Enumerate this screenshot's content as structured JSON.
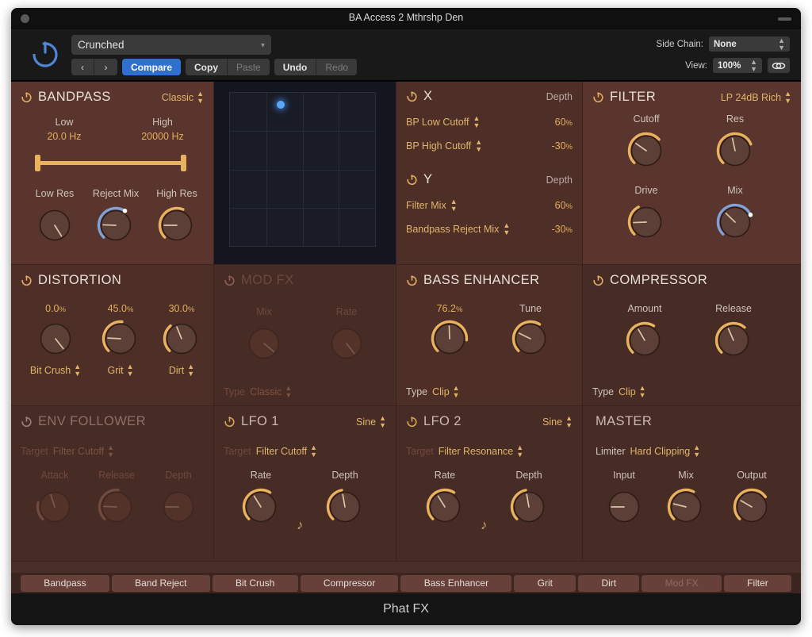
{
  "window": {
    "title": "BA Access 2 Mthrshp Den",
    "footer_name": "Phat FX"
  },
  "toolbar": {
    "power_icon": "power-icon",
    "preset_name": "Crunched",
    "prev_label": "‹",
    "next_label": "›",
    "compare_label": "Compare",
    "copy_label": "Copy",
    "paste_label": "Paste",
    "undo_label": "Undo",
    "redo_label": "Redo",
    "sidechain_label": "Side Chain:",
    "sidechain_value": "None",
    "view_label": "View:",
    "view_value": "100%",
    "link_icon": "link-icon",
    "accent_blue": "#2f6fd0"
  },
  "bandpass": {
    "title": "BANDPASS",
    "mode": "Classic",
    "low_label": "Low",
    "low_value": "20.0 Hz",
    "high_label": "High",
    "high_value": "20000 Hz",
    "knobs": [
      {
        "label": "Low Res",
        "arc": 0,
        "angle": -122
      },
      {
        "label": "Reject Mix",
        "arc": 62,
        "angle": 2
      },
      {
        "label": "High Res",
        "arc": 58,
        "angle": 0
      }
    ]
  },
  "xypad": {
    "dot_x_pct": 35,
    "dot_y_pct": 8,
    "grid_divisions": 4
  },
  "xy_assign": {
    "x_title": "X",
    "x_depth_label": "Depth",
    "x_rows": [
      {
        "name": "BP Low Cutoff",
        "value": "60",
        "unit": "%"
      },
      {
        "name": "BP High Cutoff",
        "value": "-30",
        "unit": "%"
      }
    ],
    "y_title": "Y",
    "y_depth_label": "Depth",
    "y_rows": [
      {
        "name": "Filter Mix",
        "value": "60",
        "unit": "%"
      },
      {
        "name": "Bandpass Reject Mix",
        "value": "-30",
        "unit": "%"
      }
    ]
  },
  "filter": {
    "title": "FILTER",
    "mode": "LP 24dB Rich",
    "knobs": [
      {
        "label": "Cutoff",
        "arc": 68,
        "angle": 35
      },
      {
        "label": "Res",
        "arc": 75,
        "angle": 78
      },
      {
        "label": "Drive",
        "arc": 40,
        "angle": -2
      },
      {
        "label": "Mix",
        "arc": 74,
        "angle": 44,
        "color": "blue"
      }
    ]
  },
  "distortion": {
    "title": "DISTORTION",
    "knobs": [
      {
        "value": "0.0",
        "unit": "%",
        "label": "Bit Crush",
        "arc": 0,
        "angle": -128
      },
      {
        "value": "45.0",
        "unit": "%",
        "label": "Grit",
        "arc": 52,
        "angle": 3
      },
      {
        "value": "30.0",
        "unit": "%",
        "label": "Dirt",
        "arc": 35,
        "angle": 68
      }
    ]
  },
  "modfx": {
    "title": "MOD FX",
    "enabled": false,
    "knobs": [
      {
        "label": "Mix",
        "arc": 0,
        "angle": -140
      },
      {
        "label": "Rate",
        "arc": 0,
        "angle": -128
      }
    ],
    "type_key": "Type",
    "type_value": "Classic"
  },
  "bass_enhancer": {
    "title": "BASS ENHANCER",
    "knobs": [
      {
        "value": "76.2",
        "unit": "%",
        "arc": 85,
        "angle": 88
      },
      {
        "label": "Tune",
        "arc": 62,
        "angle": 26
      }
    ],
    "type_key": "Type",
    "type_value": "Clip"
  },
  "compressor": {
    "title": "COMPRESSOR",
    "knobs": [
      {
        "label": "Amount",
        "arc": 62,
        "angle": 60
      },
      {
        "label": "Release",
        "arc": 65,
        "angle": 66
      }
    ],
    "type_key": "Type",
    "type_value": "Clip"
  },
  "env_follower": {
    "title": "ENV FOLLOWER",
    "enabled": false,
    "target_key": "Target",
    "target_value": "Filter Cutoff",
    "knobs": [
      {
        "label": "Attack",
        "arc": 22,
        "angle": 72
      },
      {
        "label": "Release",
        "arc": 52,
        "angle": 2
      },
      {
        "label": "Depth",
        "arc": 0,
        "angle": 0
      }
    ]
  },
  "lfo1": {
    "title": "LFO 1",
    "wave": "Sine",
    "target_key": "Target",
    "target_value": "Filter Cutoff",
    "knobs": [
      {
        "label": "Rate",
        "arc": 62,
        "angle": 58
      },
      {
        "label": "Depth",
        "arc": 46,
        "angle": 80
      }
    ],
    "sync_icon": "note-icon"
  },
  "lfo2": {
    "title": "LFO 2",
    "wave": "Sine",
    "target_key": "Target",
    "target_value": "Filter Resonance",
    "knobs": [
      {
        "label": "Rate",
        "arc": 62,
        "angle": 58
      },
      {
        "label": "Depth",
        "arc": 46,
        "angle": 80
      }
    ],
    "sync_icon": "note-icon"
  },
  "master": {
    "title": "MASTER",
    "limiter_key": "Limiter",
    "limiter_value": "Hard Clipping",
    "knobs": [
      {
        "label": "Input",
        "arc": 0,
        "angle": 0
      },
      {
        "label": "Mix",
        "arc": 60,
        "angle": 14
      },
      {
        "label": "Output",
        "arc": 70,
        "angle": 30
      }
    ]
  },
  "tabs": [
    {
      "label": "Bandpass",
      "enabled": true
    },
    {
      "label": "Band Reject",
      "enabled": true
    },
    {
      "label": "Bit Crush",
      "enabled": true
    },
    {
      "label": "Compressor",
      "enabled": true
    },
    {
      "label": "Bass Enhancer",
      "enabled": true
    },
    {
      "label": "Grit",
      "enabled": true
    },
    {
      "label": "Dirt",
      "enabled": true
    },
    {
      "label": "Mod FX",
      "enabled": false
    },
    {
      "label": "Filter",
      "enabled": true
    }
  ],
  "colors": {
    "amber": "#e3ad5e",
    "blue": "#6f9ad8",
    "panel_a": "#59352d",
    "panel_b": "#4e2f28",
    "panel_c": "#472b25"
  }
}
